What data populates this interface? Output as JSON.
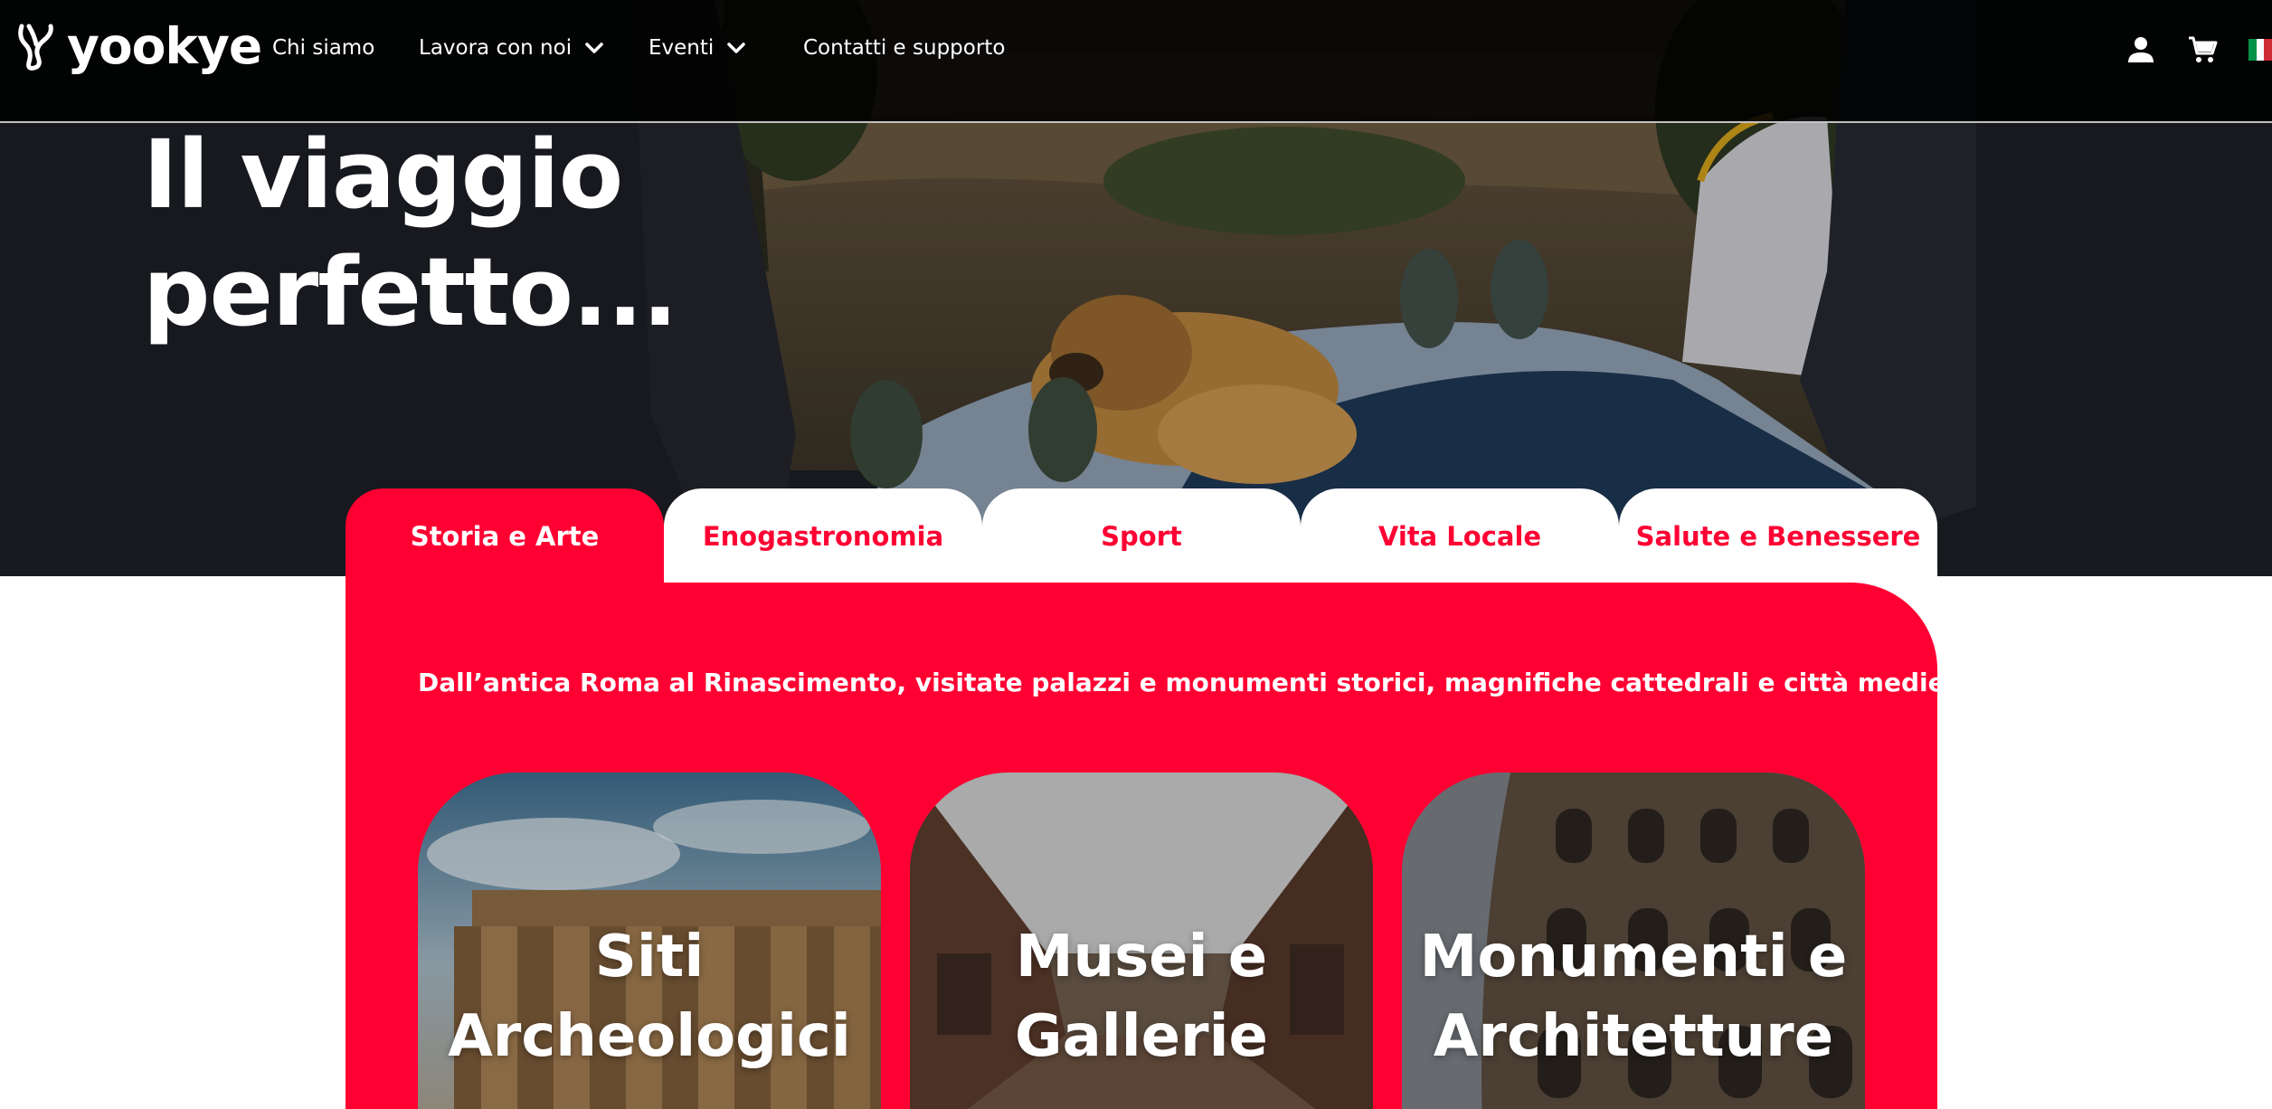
{
  "brand": {
    "name": "yookye"
  },
  "nav": {
    "items": [
      {
        "label": "Chi siamo",
        "has_dropdown": false
      },
      {
        "label": "Lavora con noi",
        "has_dropdown": true
      },
      {
        "label": "Eventi",
        "has_dropdown": true
      },
      {
        "label": "Contatti e supporto",
        "has_dropdown": false
      }
    ],
    "icons": [
      "user-icon",
      "cart-icon",
      "italian-flag-icon"
    ]
  },
  "hero": {
    "title_line1": "Il viaggio",
    "title_line2": "perfetto..."
  },
  "tabs": [
    {
      "label": "Storia e Arte",
      "active": true
    },
    {
      "label": "Enogastronomia",
      "active": false
    },
    {
      "label": "Sport",
      "active": false
    },
    {
      "label": "Vita Locale",
      "active": false
    },
    {
      "label": "Salute e Benessere",
      "active": false
    }
  ],
  "panel": {
    "description": "Dall’antica Roma al Rinascimento, visitate palazzi e monumenti storici, magnifiche cattedrali e città medievali.",
    "cards": [
      {
        "title_line1": "Siti",
        "title_line2": "Archeologici"
      },
      {
        "title_line1": "Musei e",
        "title_line2": "Gallerie"
      },
      {
        "title_line1": "Monumenti e",
        "title_line2": "Architetture"
      }
    ]
  },
  "colors": {
    "accent": "#ff0033",
    "nav_bg": "#000000",
    "text_light": "#ffffff"
  }
}
